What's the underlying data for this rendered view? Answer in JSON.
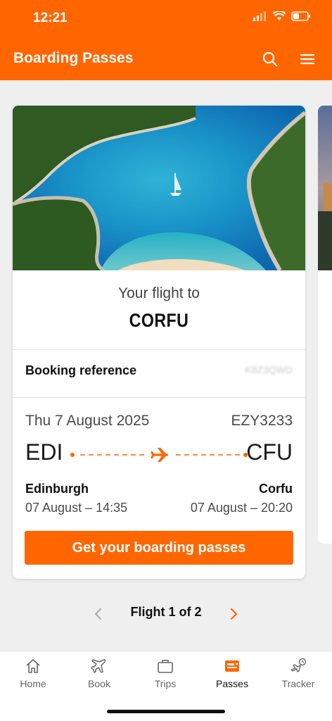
{
  "status_bar": {
    "time": "12:21"
  },
  "header": {
    "title": "Boarding Passes"
  },
  "card": {
    "your_flight_to": "Your flight to",
    "destination": "CORFU",
    "booking_reference_label": "Booking reference",
    "booking_reference_value": "K8Z3QWD",
    "date": "Thu 7 August 2025",
    "flight_number": "EZY3233",
    "origin_code": "EDI",
    "destination_code": "CFU",
    "origin_city": "Edinburgh",
    "destination_city": "Corfu",
    "departure": "07 August – 14:35",
    "arrival": "07 August – 20:20",
    "cta_label": "Get your boarding passes"
  },
  "pager": {
    "label": "Flight 1 of 2"
  },
  "tabs": [
    {
      "label": "Home",
      "icon": "home-icon"
    },
    {
      "label": "Book",
      "icon": "plane-icon"
    },
    {
      "label": "Trips",
      "icon": "briefcase-icon"
    },
    {
      "label": "Passes",
      "icon": "ticket-icon",
      "active": true
    },
    {
      "label": "Tracker",
      "icon": "tracker-icon"
    }
  ],
  "colors": {
    "brand": "#ff6600",
    "background": "#efefef"
  }
}
